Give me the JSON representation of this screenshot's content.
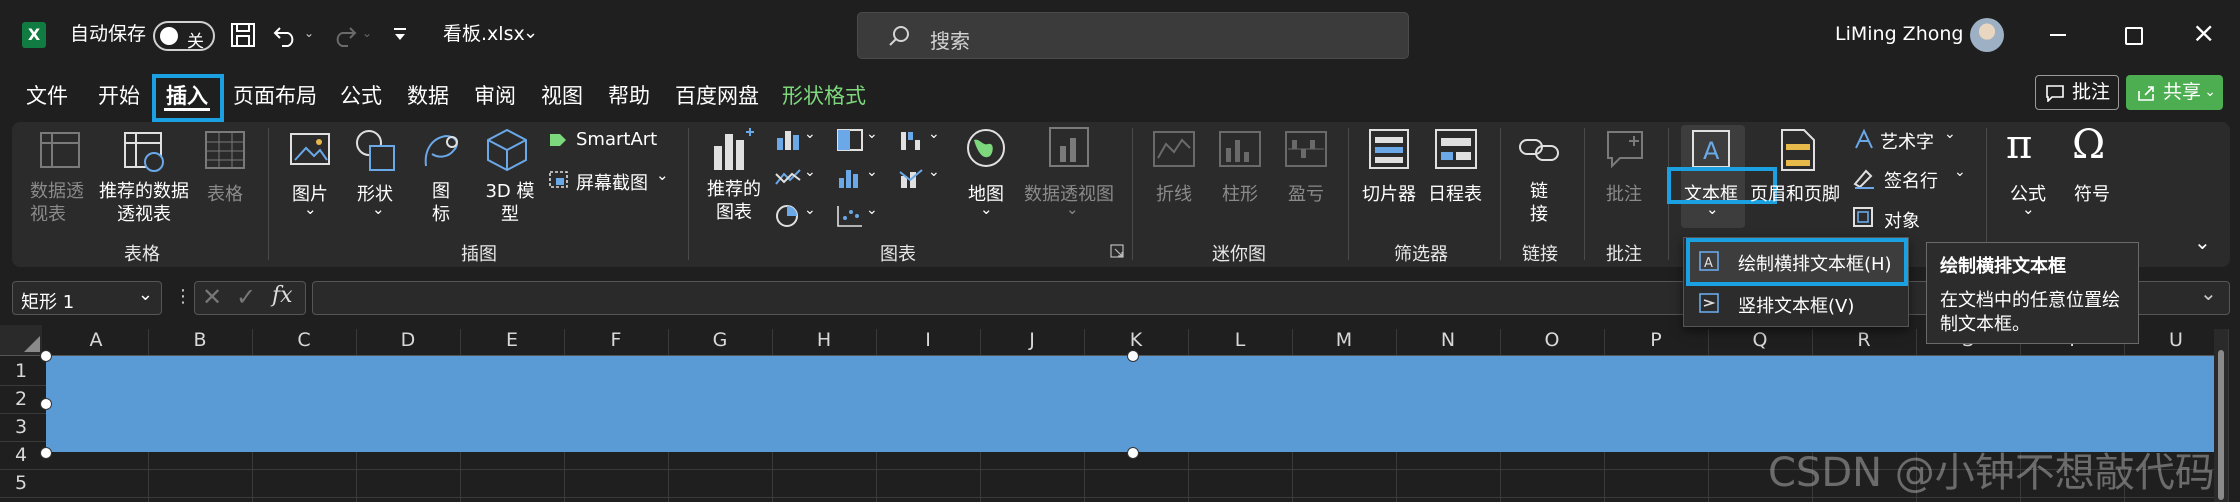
{
  "titlebar": {
    "autosave_label": "自动保存",
    "autosave_state": "关",
    "filename": "看板.xlsx",
    "search_placeholder": "搜索",
    "user": "LiMing Zhong"
  },
  "menu": {
    "tabs": [
      "文件",
      "开始",
      "插入",
      "页面布局",
      "公式",
      "数据",
      "审阅",
      "视图",
      "帮助",
      "百度网盘",
      "形状格式"
    ],
    "selected": "插入",
    "comment_btn": "批注",
    "share_btn": "共享"
  },
  "ribbon": {
    "pivot": "数据透视表",
    "recommended_pivot": "推荐的数据透视表",
    "table": "表格",
    "picture": "图片",
    "shapes": "形状",
    "icons": "图标",
    "model3d": "3D 模型",
    "smartart": "SmartArt",
    "screenshot": "屏幕截图",
    "recommended_chart": "推荐的图表",
    "map": "地图",
    "pivot_chart": "数据透视图",
    "line": "折线",
    "column": "柱形",
    "winloss": "盈亏",
    "slicer": "切片器",
    "timeline": "日程表",
    "link": "链接",
    "comment": "批注",
    "textbox": "文本框",
    "header_footer": "页眉和页脚",
    "wordart": "艺术字",
    "signature": "签名行",
    "object": "对象",
    "equation": "公式",
    "symbol": "符号",
    "groups": {
      "tables": "表格",
      "illustrations": "插图",
      "charts": "图表",
      "sparklines": "迷你图",
      "filters": "筛选器",
      "links": "链接",
      "comments": "批注"
    }
  },
  "formula_bar": {
    "name_box": "矩形 1",
    "fx": "fx"
  },
  "grid": {
    "columns": [
      "A",
      "B",
      "C",
      "D",
      "E",
      "F",
      "G",
      "H",
      "I",
      "J",
      "K",
      "L",
      "M",
      "N",
      "O",
      "P",
      "Q",
      "R",
      "S",
      "T",
      "U"
    ],
    "rows": [
      "1",
      "2",
      "3",
      "4",
      "5"
    ]
  },
  "dropdown": {
    "item1": "绘制横排文本框(H)",
    "item2": "竖排文本框(V)"
  },
  "tooltip": {
    "title": "绘制横排文本框",
    "body1": "在文档中的任意位置绘",
    "body2": "制文本框。"
  },
  "watermark": "CSDN @小钟不想敲代码",
  "colors": {
    "accent_highlight": "#1ba1e2",
    "shape_fill": "#5b9bd5",
    "share_green": "#4cae50"
  }
}
